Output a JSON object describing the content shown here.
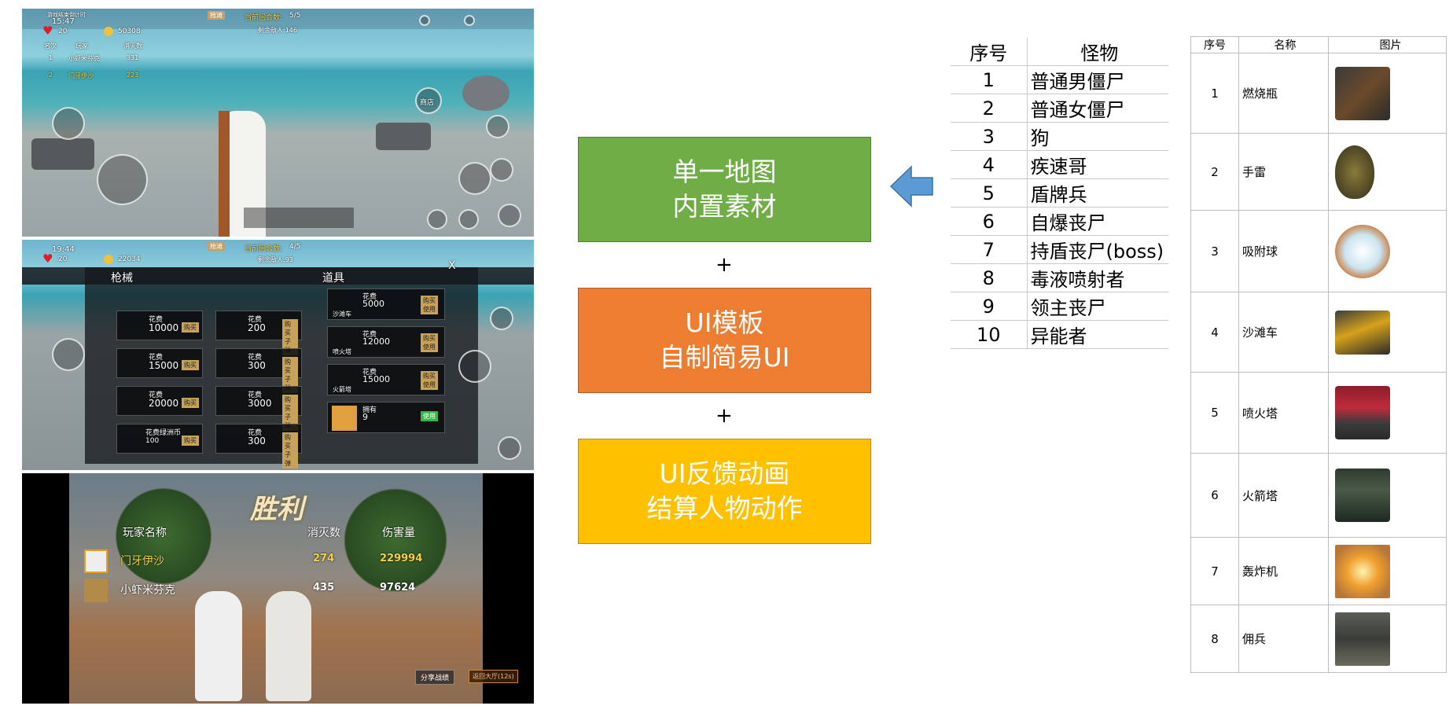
{
  "shot1": {
    "time": "15:47",
    "title_tag": "游戏结束倒计时",
    "mode_badge": "抢滩",
    "round_label": "当前回合数:",
    "round_value": "5/5",
    "enemies_left": "剩余敌人:146",
    "hp": "20",
    "coins": "50308",
    "col_rank": "名次",
    "col_player": "玩家",
    "col_kills": "消灭数",
    "rows": [
      {
        "rank": "1",
        "name": "小虾米芬克",
        "kills": "331"
      },
      {
        "rank": "2",
        "name": "门牙伊沙",
        "kills": "223"
      }
    ],
    "shop_label": "商店"
  },
  "shot2": {
    "time": "19:44",
    "mode_badge": "抢滩",
    "round_label": "当前回合数:",
    "round_value": "4/5",
    "enemies_left": "剩余敌人:93",
    "hp": "20",
    "coins": "22034",
    "tab_guns": "枪械",
    "tab_items": "道具",
    "close": "X",
    "guns": [
      {
        "label": "花费",
        "price": "10000",
        "btn": "购买"
      },
      {
        "label": "花费",
        "price": "15000",
        "btn": "购买"
      },
      {
        "label": "花费",
        "price": "20000",
        "btn": "购买"
      },
      {
        "label": "花费绿洲币",
        "price": "100",
        "btn": "购买"
      }
    ],
    "ammo": [
      {
        "label": "花费",
        "price": "200",
        "btn": "购买子弹"
      },
      {
        "label": "花费",
        "price": "300",
        "btn": "购买子弹"
      },
      {
        "label": "花费",
        "price": "3000",
        "btn": "购买子弹"
      },
      {
        "label": "花费",
        "price": "300",
        "btn": "购买子弹"
      }
    ],
    "props": [
      {
        "name": "沙滩车",
        "label": "花费",
        "price": "5000",
        "btn": "购买使用"
      },
      {
        "name": "喷火塔",
        "label": "花费",
        "price": "12000",
        "btn": "购买使用"
      },
      {
        "name": "火箭塔",
        "label": "花费",
        "price": "15000",
        "btn": "购买使用"
      },
      {
        "name": "轰炸机",
        "label": "拥有",
        "price": "9",
        "btn": "使用"
      }
    ]
  },
  "shot3": {
    "victory": "胜利",
    "col_name": "玩家名称",
    "col_kills": "消灭数",
    "col_damage": "伤害量",
    "rows": [
      {
        "name": "门牙伊沙",
        "kills": "274",
        "damage": "229994"
      },
      {
        "name": "小虾米芬克",
        "kills": "435",
        "damage": "97624"
      }
    ],
    "share_btn": "分享战绩",
    "lobby_btn": "返回大厅(12s)"
  },
  "boxes": [
    {
      "line1": "单一地图",
      "line2": "内置素材",
      "color": "#70ad47"
    },
    {
      "line1": "UI模板",
      "line2": "自制简易UI",
      "color": "#ed7d31"
    },
    {
      "line1": "UI反馈动画",
      "line2": "结算人物动作",
      "color": "#ffc000"
    }
  ],
  "plus": "+",
  "monster_table": {
    "header_no": "序号",
    "header_name": "怪物",
    "rows": [
      {
        "no": "1",
        "name": "普通男僵尸"
      },
      {
        "no": "2",
        "name": "普通女僵尸"
      },
      {
        "no": "3",
        "name": "狗"
      },
      {
        "no": "4",
        "name": "疾速哥"
      },
      {
        "no": "5",
        "name": "盾牌兵"
      },
      {
        "no": "6",
        "name": "自爆丧尸"
      },
      {
        "no": "7",
        "name": "持盾丧尸(boss)"
      },
      {
        "no": "8",
        "name": "毒液喷射者"
      },
      {
        "no": "9",
        "name": "领主丧尸"
      },
      {
        "no": "10",
        "name": "异能者"
      }
    ]
  },
  "item_table": {
    "header_no": "序号",
    "header_name": "名称",
    "header_pic": "图片",
    "rows": [
      {
        "no": "1",
        "name": "燃烧瓶",
        "icon": "molotov-icon"
      },
      {
        "no": "2",
        "name": "手雷",
        "icon": "grenade-icon"
      },
      {
        "no": "3",
        "name": "吸附球",
        "icon": "sticky-ball-icon"
      },
      {
        "no": "4",
        "name": "沙滩车",
        "icon": "buggy-icon"
      },
      {
        "no": "5",
        "name": "喷火塔",
        "icon": "flame-tower-icon"
      },
      {
        "no": "6",
        "name": "火箭塔",
        "icon": "rocket-tower-icon"
      },
      {
        "no": "7",
        "name": "轰炸机",
        "icon": "bomber-icon"
      },
      {
        "no": "8",
        "name": "佣兵",
        "icon": "mercenary-icon"
      }
    ]
  }
}
